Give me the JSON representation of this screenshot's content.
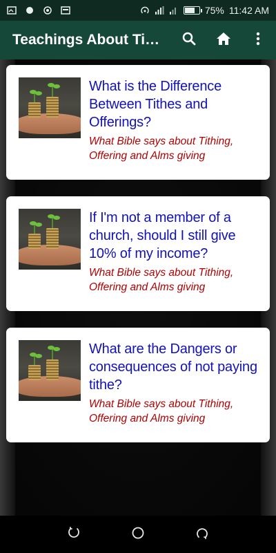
{
  "status_bar": {
    "battery": "75%",
    "battery_level": 0.75,
    "time": "11:42 AM"
  },
  "app_bar": {
    "title": "Teachings About Tithes",
    "search_icon": "search-icon",
    "home_icon": "home-icon",
    "more_icon": "more-vert-icon"
  },
  "cards": [
    {
      "title": "What is the Difference Between Tithes and Offerings?",
      "subtitle": "What Bible says about Tithing, Offering and Alms giving"
    },
    {
      "title": " If I'm not a member of a church, should I still give 10% of my income?",
      "subtitle": "What Bible says about Tithing, Offering and Alms giving"
    },
    {
      "title": "What are the Dangers or consequences of not paying tithe?",
      "subtitle": "What Bible says about Tithing, Offering and Alms giving"
    }
  ],
  "nav_bar": {
    "back_icon": "back-icon",
    "home_icon": "home-circle-icon",
    "recents_icon": "recents-icon"
  },
  "colors": {
    "app_bar": "#16483a",
    "card_title": "#1212b8",
    "card_subtitle": "#b00000"
  }
}
